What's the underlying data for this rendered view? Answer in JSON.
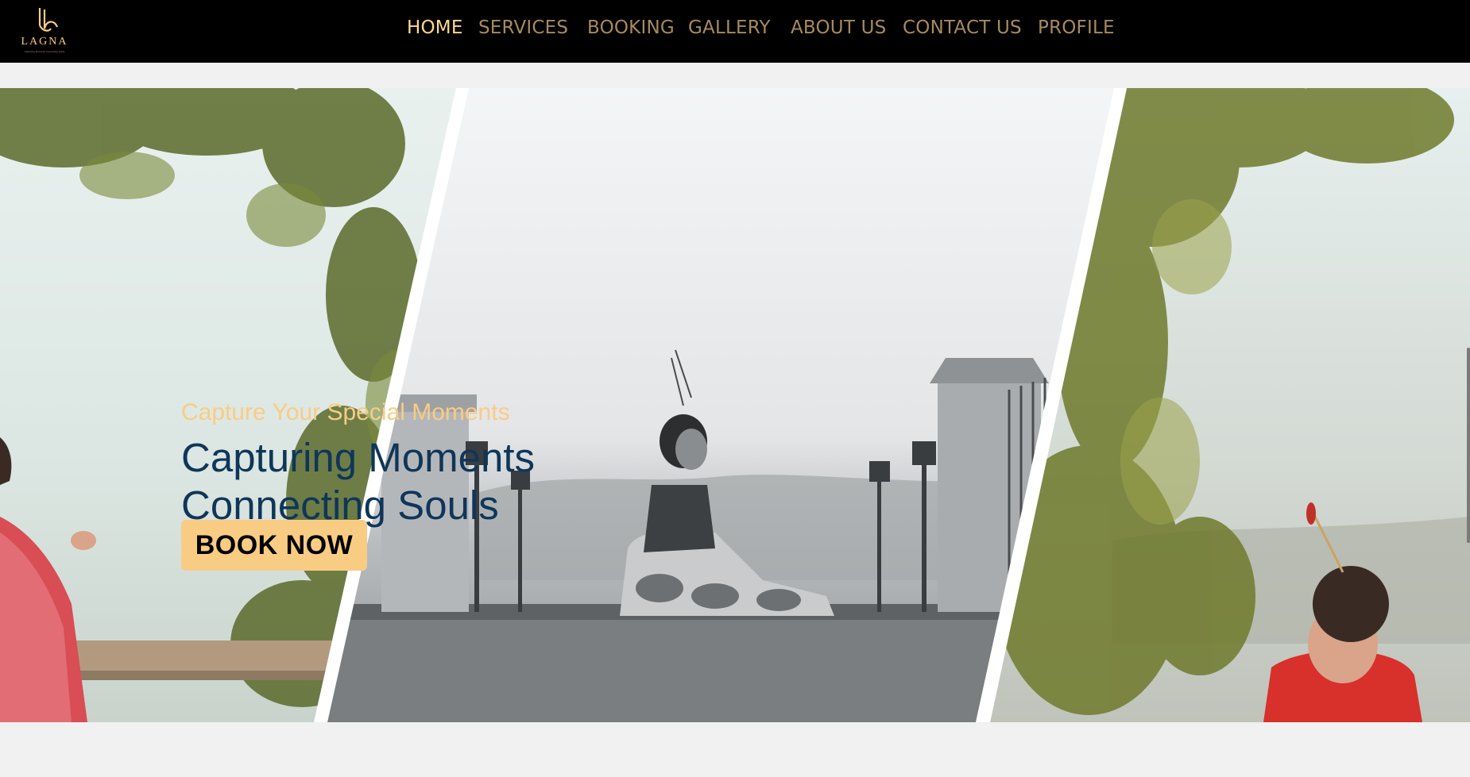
{
  "brand": {
    "logo_text": "LAGNA",
    "logo_tagline": "Capturing Moments Connecting Souls",
    "accent_color": "#f9cc84",
    "nav_active_color": "#ffd98a",
    "nav_color": "#a88a5e",
    "headline_color": "#0f3659"
  },
  "nav": {
    "items": [
      {
        "label": "HOME",
        "active": true
      },
      {
        "label": "SERVICES",
        "active": false
      },
      {
        "label": "BOOKING",
        "active": false
      },
      {
        "label": "GALLERY",
        "active": false
      },
      {
        "label": "ABOUT US",
        "active": false
      },
      {
        "label": "CONTACT US",
        "active": false
      },
      {
        "label": "PROFILE",
        "active": false
      }
    ]
  },
  "hero": {
    "tagline": "Capture Your Special Moments",
    "headline_line1": "Capturing Moments",
    "headline_line2": "Connecting Souls",
    "cta_label": "BOOK NOW"
  }
}
